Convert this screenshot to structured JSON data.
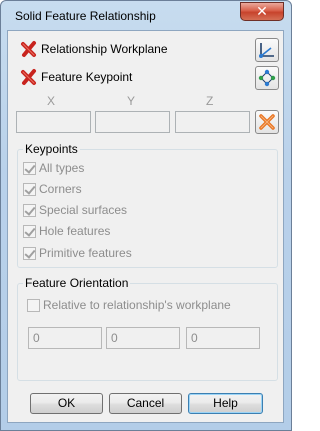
{
  "window": {
    "title": "Solid Feature Relationship",
    "close_glyph": "✕"
  },
  "relationship": {
    "workplane_label": "Relationship Workplane",
    "keypoint_label": "Feature Keypoint",
    "status_icon": "red-x-icon",
    "workplane_tool_icon": "workplane-axes-icon",
    "keypoint_tool_icon": "keypoint-points-icon"
  },
  "coordinates": {
    "x_label": "X",
    "y_label": "Y",
    "z_label": "Z",
    "x_value": "",
    "y_value": "",
    "z_value": "",
    "clear_icon": "orange-cross-icon"
  },
  "keypoints": {
    "title": "Keypoints",
    "options": [
      {
        "label": "All types",
        "checked": true
      },
      {
        "label": "Corners",
        "checked": true
      },
      {
        "label": "Special surfaces",
        "checked": true
      },
      {
        "label": "Hole features",
        "checked": true
      },
      {
        "label": "Primitive features",
        "checked": true
      }
    ]
  },
  "orientation": {
    "title": "Feature Orientation",
    "relative_label": "Relative to relationship's workplane",
    "relative_checked": false,
    "values": [
      "0",
      "0",
      "0"
    ]
  },
  "buttons": {
    "ok": "OK",
    "cancel": "Cancel",
    "help": "Help"
  },
  "colors": {
    "title_bar": "#b9d1ea",
    "close_button": "#c7432c",
    "dialog_bg": "#f0f0f0",
    "status_red": "#c8231e",
    "tool_orange": "#e8731f"
  }
}
